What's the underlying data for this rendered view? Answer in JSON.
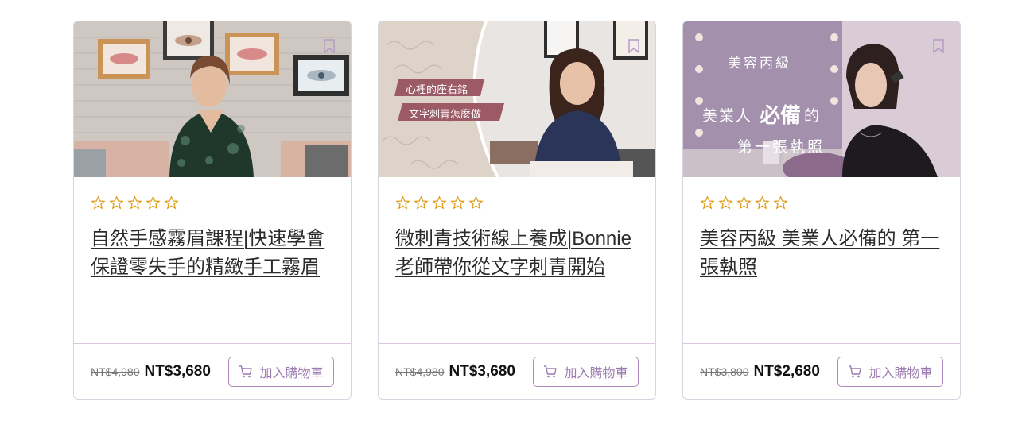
{
  "courses": [
    {
      "title": "自然手感霧眉課程|快速學會 保證零失手的精緻手工霧眉",
      "old_price": "NT$4,980",
      "price": "NT$3,680",
      "cart_label": "加入購物車",
      "rating_stars": 5,
      "image_overlay": []
    },
    {
      "title": "微刺青技術線上養成|Bonnie老師帶你從文字刺青開始",
      "old_price": "NT$4,980",
      "price": "NT$3,680",
      "cart_label": "加入購物車",
      "rating_stars": 5,
      "image_overlay": [
        "心裡的座右銘",
        "文字刺青怎麼做"
      ]
    },
    {
      "title": "美容丙級 美業人必備的 第一張執照",
      "old_price": "NT$3,800",
      "price": "NT$2,680",
      "cart_label": "加入購物車",
      "rating_stars": 5,
      "image_overlay": [
        "美容丙級",
        "美業人",
        "必備",
        "的",
        "第一張執照"
      ]
    }
  ],
  "colors": {
    "accent": "#9b7bb0",
    "star": "#e0a020",
    "border": "#d9d3e0"
  },
  "icons": [
    "bookmark-icon",
    "star-outline-icon",
    "cart-icon"
  ]
}
